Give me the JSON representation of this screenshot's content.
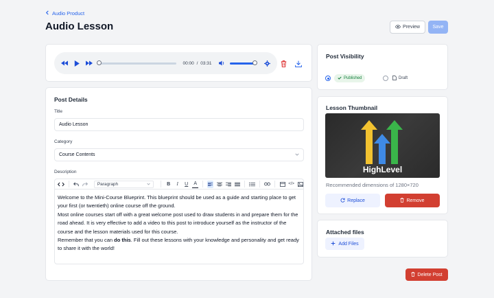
{
  "breadcrumb": {
    "label": "Audio Product"
  },
  "page": {
    "title": "Audio Lesson"
  },
  "header": {
    "preview_label": "Preview",
    "save_label": "Save"
  },
  "audio": {
    "current_time": "00:00",
    "separator": "/",
    "duration": "03:31"
  },
  "details": {
    "heading": "Post Details",
    "title_label": "Title",
    "title_value": "Audio Lesson",
    "category_label": "Category",
    "category_value": "Course Contents",
    "description_label": "Description",
    "paragraph_style": "Paragraph",
    "body": {
      "line1": "Welcome to the Mini-Course Blueprint. This blueprint should be used as a guide and starting place to get your first (or twentieth) online course off the ground.",
      "line2": "Most online courses start off with a great welcome post used to draw students in and prepare them for the road ahead. It is very effective to add a video to this post to introduce yourself as the instructor of the course and the lesson materials used for this course.",
      "line3_pre": "Remember that you can ",
      "line3_bold": "do this",
      "line3_post": ". Fill out these lessons with your knowledge and personality and get ready to share it with the world!"
    }
  },
  "visibility": {
    "heading": "Post Visibility",
    "published_label": "Published",
    "draft_label": "Draft",
    "selected": "Published"
  },
  "thumbnail": {
    "heading": "Lesson Thumbnail",
    "brand_text": "HighLevel",
    "hint": "Recommended dimensions of 1280×720",
    "replace_label": "Replace",
    "remove_label": "Remove"
  },
  "files": {
    "heading": "Attached files",
    "add_label": "Add Files"
  },
  "footer": {
    "delete_label": "Delete Post"
  },
  "colors": {
    "accent": "#2563eb",
    "danger": "#d23f31",
    "success": "#15803d"
  }
}
